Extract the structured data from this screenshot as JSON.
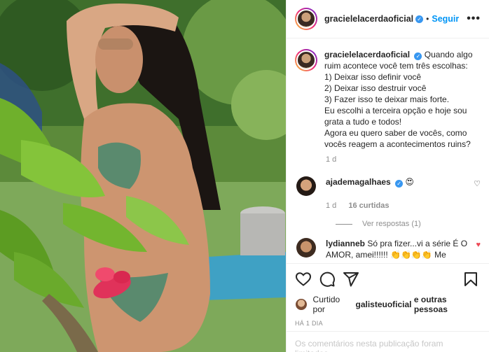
{
  "post": {
    "username": "gracielelacerdaoficial",
    "verified_mark": "✓",
    "separator": "•",
    "follow_label": "Seguir",
    "more_label": "•••"
  },
  "caption": {
    "username": "gracielelacerdaoficial",
    "lines": [
      "Quando algo ruim acontece você tem três escolhas:",
      "1) Deixar isso definir você",
      "2) Deixar isso destruir você",
      "3) Fazer isso te deixar mais forte.",
      "Eu escolhi a terceira opção e hoje sou grata a tudo e todos!",
      "Agora eu quero saber de vocês, como vocês reagem a acontecimentos ruins?"
    ],
    "age": "1 d"
  },
  "comments": [
    {
      "username": "ajademagalhaes",
      "text": "😍",
      "age": "1 d",
      "likes": "16 curtidas",
      "replies_label": "Ver respostas (1)"
    },
    {
      "username": "lydianneb",
      "text": "Só pra fizer...vi a série É O AMOR, amei!!!!!! 👏👏👏👏 Me"
    }
  ],
  "engagement": {
    "liked_by_prefix": "Curtido por",
    "liked_by_user": "galisteuoficial",
    "liked_by_suffix": "e outras pessoas",
    "time": "HÁ 1 DIA"
  },
  "footer": {
    "limited_text": "Os comentários nesta publicação foram limitados."
  },
  "colors": {
    "link_blue": "#0095f6",
    "verified_blue": "#3897f0",
    "muted": "#8e8e8e",
    "heart_red": "#ed4956"
  },
  "icons": [
    "heart-icon",
    "comment-icon",
    "share-icon",
    "bookmark-icon",
    "verified-icon",
    "more-options-icon"
  ]
}
